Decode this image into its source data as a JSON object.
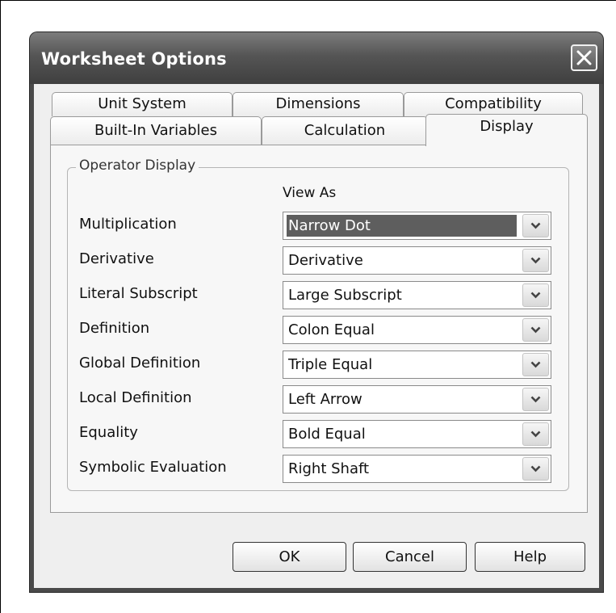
{
  "window": {
    "title": "Worksheet Options"
  },
  "tabs_back": [
    "Unit System",
    "Dimensions",
    "Compatibility"
  ],
  "tabs_front": [
    "Built-In Variables",
    "Calculation",
    "Display"
  ],
  "active_tab": "Display",
  "group": {
    "title": "Operator Display",
    "column_header": "View As"
  },
  "rows": [
    {
      "label": "Multiplication",
      "value": "Narrow Dot",
      "selected": true
    },
    {
      "label": "Derivative",
      "value": "Derivative"
    },
    {
      "label": "Literal Subscript",
      "value": "Large Subscript"
    },
    {
      "label": "Definition",
      "value": "Colon Equal"
    },
    {
      "label": "Global Definition",
      "value": "Triple Equal"
    },
    {
      "label": "Local Definition",
      "value": "Left Arrow"
    },
    {
      "label": "Equality",
      "value": "Bold Equal"
    },
    {
      "label": "Symbolic Evaluation",
      "value": "Right Shaft"
    }
  ],
  "buttons": {
    "ok": "OK",
    "cancel": "Cancel",
    "help": "Help"
  },
  "colors": {
    "titlebar": "#4a4a4a",
    "selection": "#5e5e5e",
    "dialog_bg": "#efefef"
  }
}
